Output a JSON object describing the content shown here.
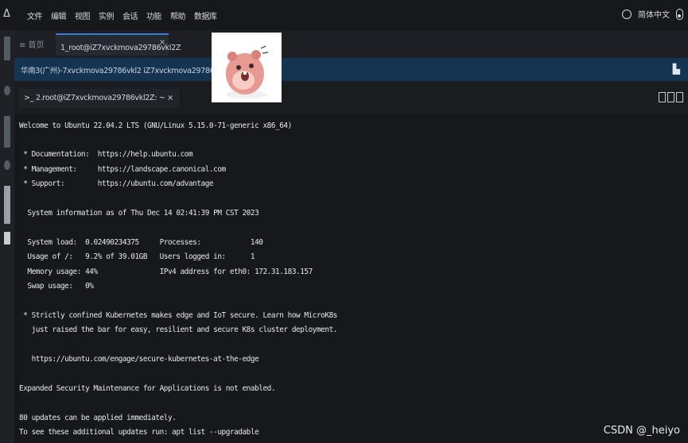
{
  "app": {
    "logo": "Δ",
    "menu": [
      "文件",
      "编辑",
      "视图",
      "实例",
      "会话",
      "功能",
      "帮助",
      "数据库"
    ],
    "language": "简体中文"
  },
  "tabs": {
    "home_label": "≡  首页",
    "active_label": "1_root@iZ7xvckmova29786vkl2Z",
    "close": "×"
  },
  "session": {
    "path": "华南3(广州)-7xvckmova29786vkl2   iZ7xvckmova29786vkl2Z   root"
  },
  "terminal_tab": {
    "label": ">_ 2.root@iZ7xvckmova29786vkl2Z: ~",
    "close": "×"
  },
  "terminal": {
    "lines": [
      "Welcome to Ubuntu 22.04.2 LTS (GNU/Linux 5.15.0-71-generic x86_64)",
      " * Documentation:  https://help.ubuntu.com",
      " * Management:     https://landscape.canonical.com",
      " * Support:        https://ubuntu.com/advantage",
      "  System information as of Thu Dec 14 02:41:39 PM CST 2023",
      "  System load:  0.02490234375     Processes:            140",
      "  Usage of /:   9.2% of 39.01GB   Users logged in:      1",
      "  Memory usage: 44%               IPv4 address for eth0: 172.31.183.157",
      "  Swap usage:   0%",
      " * Strictly confined Kubernetes makes edge and IoT secure. Learn how MicroK8s",
      "   just raised the bar for easy, resilient and secure K8s cluster deployment.",
      "   https://ubuntu.com/engage/secure-kubernetes-at-the-edge",
      "Expanded Security Maintenance for Applications is not enabled.",
      "80 updates can be applied immediately.",
      "To see these additional updates run: apt list --upgradable"
    ]
  },
  "watermark": "CSDN @_heiyo"
}
